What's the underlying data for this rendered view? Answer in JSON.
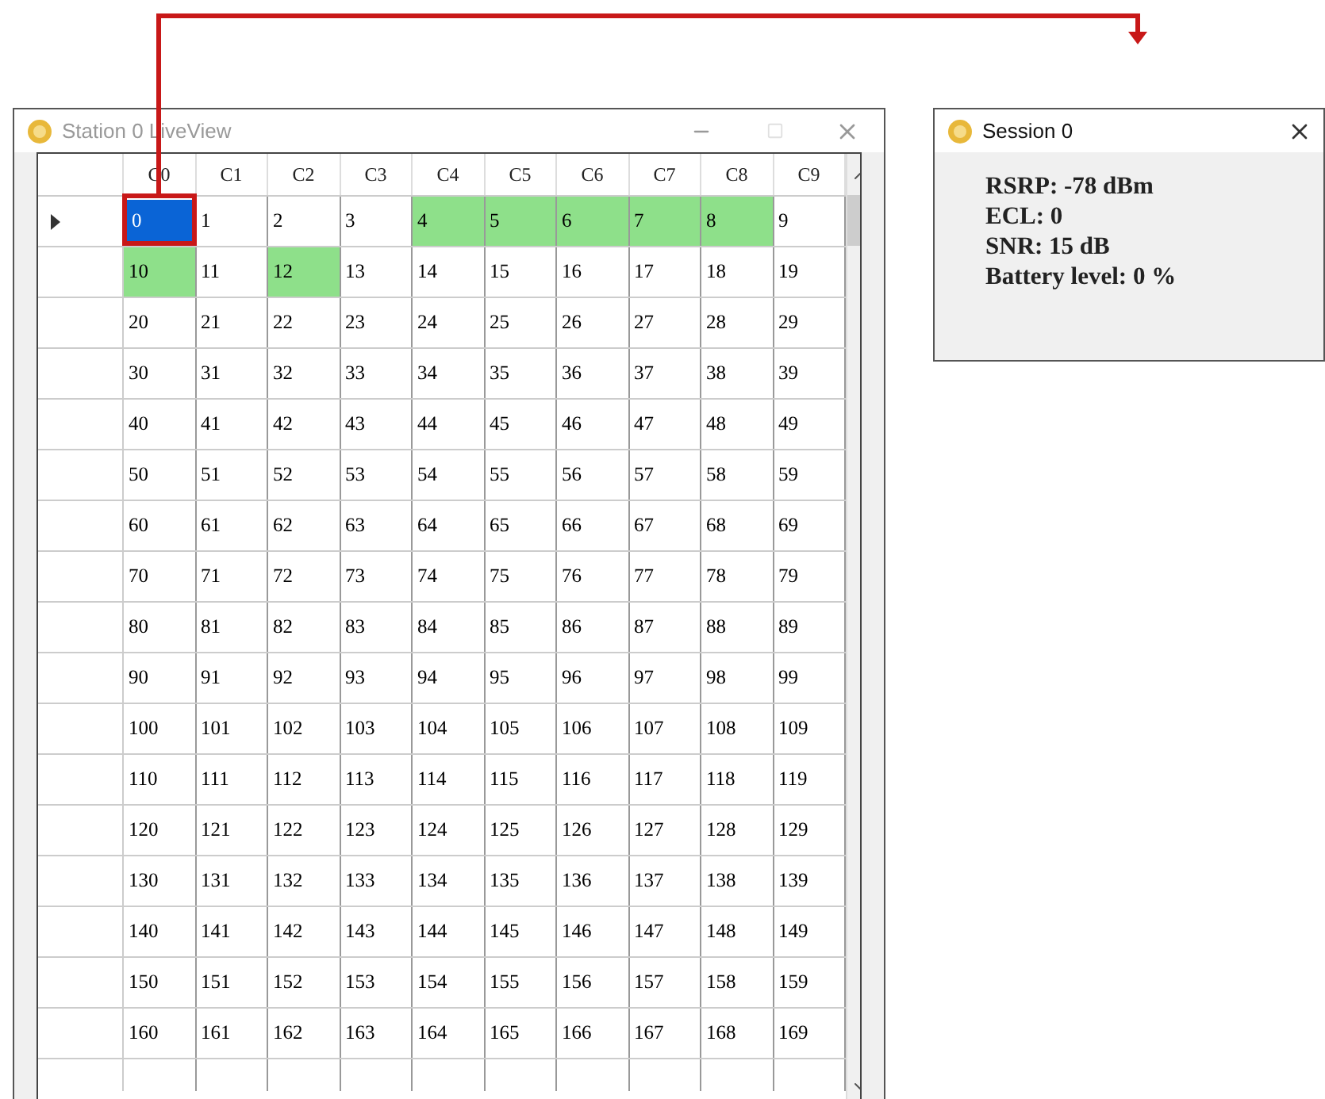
{
  "live_view_window": {
    "title": "Station 0 LiveView",
    "maximize_disabled": true,
    "grid": {
      "columns": [
        "C0",
        "C1",
        "C2",
        "C3",
        "C4",
        "C5",
        "C6",
        "C7",
        "C8",
        "C9"
      ],
      "rows": [
        {
          "current": true,
          "cells": [
            {
              "text": "0",
              "selected": true,
              "highlighted": false
            },
            {
              "text": "1",
              "selected": false,
              "highlighted": false
            },
            {
              "text": "2",
              "selected": false,
              "highlighted": false
            },
            {
              "text": "3",
              "selected": false,
              "highlighted": false
            },
            {
              "text": "4",
              "selected": false,
              "highlighted": true
            },
            {
              "text": "5",
              "selected": false,
              "highlighted": true
            },
            {
              "text": "6",
              "selected": false,
              "highlighted": true
            },
            {
              "text": "7",
              "selected": false,
              "highlighted": true
            },
            {
              "text": "8",
              "selected": false,
              "highlighted": true
            },
            {
              "text": "9",
              "selected": false,
              "highlighted": false
            }
          ]
        },
        {
          "current": false,
          "cells": [
            {
              "text": "10",
              "selected": false,
              "highlighted": true
            },
            {
              "text": "11",
              "selected": false,
              "highlighted": false
            },
            {
              "text": "12",
              "selected": false,
              "highlighted": true
            },
            {
              "text": "13",
              "selected": false,
              "highlighted": false
            },
            {
              "text": "14",
              "selected": false,
              "highlighted": false
            },
            {
              "text": "15",
              "selected": false,
              "highlighted": false
            },
            {
              "text": "16",
              "selected": false,
              "highlighted": false
            },
            {
              "text": "17",
              "selected": false,
              "highlighted": false
            },
            {
              "text": "18",
              "selected": false,
              "highlighted": false
            },
            {
              "text": "19",
              "selected": false,
              "highlighted": false
            }
          ]
        },
        {
          "current": false,
          "cells": [
            {
              "text": "20",
              "selected": false,
              "highlighted": false
            },
            {
              "text": "21",
              "selected": false,
              "highlighted": false
            },
            {
              "text": "22",
              "selected": false,
              "highlighted": false
            },
            {
              "text": "23",
              "selected": false,
              "highlighted": false
            },
            {
              "text": "24",
              "selected": false,
              "highlighted": false
            },
            {
              "text": "25",
              "selected": false,
              "highlighted": false
            },
            {
              "text": "26",
              "selected": false,
              "highlighted": false
            },
            {
              "text": "27",
              "selected": false,
              "highlighted": false
            },
            {
              "text": "28",
              "selected": false,
              "highlighted": false
            },
            {
              "text": "29",
              "selected": false,
              "highlighted": false
            }
          ]
        },
        {
          "current": false,
          "cells": [
            {
              "text": "30",
              "selected": false,
              "highlighted": false
            },
            {
              "text": "31",
              "selected": false,
              "highlighted": false
            },
            {
              "text": "32",
              "selected": false,
              "highlighted": false
            },
            {
              "text": "33",
              "selected": false,
              "highlighted": false
            },
            {
              "text": "34",
              "selected": false,
              "highlighted": false
            },
            {
              "text": "35",
              "selected": false,
              "highlighted": false
            },
            {
              "text": "36",
              "selected": false,
              "highlighted": false
            },
            {
              "text": "37",
              "selected": false,
              "highlighted": false
            },
            {
              "text": "38",
              "selected": false,
              "highlighted": false
            },
            {
              "text": "39",
              "selected": false,
              "highlighted": false
            }
          ]
        },
        {
          "current": false,
          "cells": [
            {
              "text": "40",
              "selected": false,
              "highlighted": false
            },
            {
              "text": "41",
              "selected": false,
              "highlighted": false
            },
            {
              "text": "42",
              "selected": false,
              "highlighted": false
            },
            {
              "text": "43",
              "selected": false,
              "highlighted": false
            },
            {
              "text": "44",
              "selected": false,
              "highlighted": false
            },
            {
              "text": "45",
              "selected": false,
              "highlighted": false
            },
            {
              "text": "46",
              "selected": false,
              "highlighted": false
            },
            {
              "text": "47",
              "selected": false,
              "highlighted": false
            },
            {
              "text": "48",
              "selected": false,
              "highlighted": false
            },
            {
              "text": "49",
              "selected": false,
              "highlighted": false
            }
          ]
        },
        {
          "current": false,
          "cells": [
            {
              "text": "50",
              "selected": false,
              "highlighted": false
            },
            {
              "text": "51",
              "selected": false,
              "highlighted": false
            },
            {
              "text": "52",
              "selected": false,
              "highlighted": false
            },
            {
              "text": "53",
              "selected": false,
              "highlighted": false
            },
            {
              "text": "54",
              "selected": false,
              "highlighted": false
            },
            {
              "text": "55",
              "selected": false,
              "highlighted": false
            },
            {
              "text": "56",
              "selected": false,
              "highlighted": false
            },
            {
              "text": "57",
              "selected": false,
              "highlighted": false
            },
            {
              "text": "58",
              "selected": false,
              "highlighted": false
            },
            {
              "text": "59",
              "selected": false,
              "highlighted": false
            }
          ]
        },
        {
          "current": false,
          "cells": [
            {
              "text": "60",
              "selected": false,
              "highlighted": false
            },
            {
              "text": "61",
              "selected": false,
              "highlighted": false
            },
            {
              "text": "62",
              "selected": false,
              "highlighted": false
            },
            {
              "text": "63",
              "selected": false,
              "highlighted": false
            },
            {
              "text": "64",
              "selected": false,
              "highlighted": false
            },
            {
              "text": "65",
              "selected": false,
              "highlighted": false
            },
            {
              "text": "66",
              "selected": false,
              "highlighted": false
            },
            {
              "text": "67",
              "selected": false,
              "highlighted": false
            },
            {
              "text": "68",
              "selected": false,
              "highlighted": false
            },
            {
              "text": "69",
              "selected": false,
              "highlighted": false
            }
          ]
        },
        {
          "current": false,
          "cells": [
            {
              "text": "70",
              "selected": false,
              "highlighted": false
            },
            {
              "text": "71",
              "selected": false,
              "highlighted": false
            },
            {
              "text": "72",
              "selected": false,
              "highlighted": false
            },
            {
              "text": "73",
              "selected": false,
              "highlighted": false
            },
            {
              "text": "74",
              "selected": false,
              "highlighted": false
            },
            {
              "text": "75",
              "selected": false,
              "highlighted": false
            },
            {
              "text": "76",
              "selected": false,
              "highlighted": false
            },
            {
              "text": "77",
              "selected": false,
              "highlighted": false
            },
            {
              "text": "78",
              "selected": false,
              "highlighted": false
            },
            {
              "text": "79",
              "selected": false,
              "highlighted": false
            }
          ]
        },
        {
          "current": false,
          "cells": [
            {
              "text": "80",
              "selected": false,
              "highlighted": false
            },
            {
              "text": "81",
              "selected": false,
              "highlighted": false
            },
            {
              "text": "82",
              "selected": false,
              "highlighted": false
            },
            {
              "text": "83",
              "selected": false,
              "highlighted": false
            },
            {
              "text": "84",
              "selected": false,
              "highlighted": false
            },
            {
              "text": "85",
              "selected": false,
              "highlighted": false
            },
            {
              "text": "86",
              "selected": false,
              "highlighted": false
            },
            {
              "text": "87",
              "selected": false,
              "highlighted": false
            },
            {
              "text": "88",
              "selected": false,
              "highlighted": false
            },
            {
              "text": "89",
              "selected": false,
              "highlighted": false
            }
          ]
        },
        {
          "current": false,
          "cells": [
            {
              "text": "90",
              "selected": false,
              "highlighted": false
            },
            {
              "text": "91",
              "selected": false,
              "highlighted": false
            },
            {
              "text": "92",
              "selected": false,
              "highlighted": false
            },
            {
              "text": "93",
              "selected": false,
              "highlighted": false
            },
            {
              "text": "94",
              "selected": false,
              "highlighted": false
            },
            {
              "text": "95",
              "selected": false,
              "highlighted": false
            },
            {
              "text": "96",
              "selected": false,
              "highlighted": false
            },
            {
              "text": "97",
              "selected": false,
              "highlighted": false
            },
            {
              "text": "98",
              "selected": false,
              "highlighted": false
            },
            {
              "text": "99",
              "selected": false,
              "highlighted": false
            }
          ]
        },
        {
          "current": false,
          "cells": [
            {
              "text": "100",
              "selected": false,
              "highlighted": false
            },
            {
              "text": "101",
              "selected": false,
              "highlighted": false
            },
            {
              "text": "102",
              "selected": false,
              "highlighted": false
            },
            {
              "text": "103",
              "selected": false,
              "highlighted": false
            },
            {
              "text": "104",
              "selected": false,
              "highlighted": false
            },
            {
              "text": "105",
              "selected": false,
              "highlighted": false
            },
            {
              "text": "106",
              "selected": false,
              "highlighted": false
            },
            {
              "text": "107",
              "selected": false,
              "highlighted": false
            },
            {
              "text": "108",
              "selected": false,
              "highlighted": false
            },
            {
              "text": "109",
              "selected": false,
              "highlighted": false
            }
          ]
        },
        {
          "current": false,
          "cells": [
            {
              "text": "110",
              "selected": false,
              "highlighted": false
            },
            {
              "text": "111",
              "selected": false,
              "highlighted": false
            },
            {
              "text": "112",
              "selected": false,
              "highlighted": false
            },
            {
              "text": "113",
              "selected": false,
              "highlighted": false
            },
            {
              "text": "114",
              "selected": false,
              "highlighted": false
            },
            {
              "text": "115",
              "selected": false,
              "highlighted": false
            },
            {
              "text": "116",
              "selected": false,
              "highlighted": false
            },
            {
              "text": "117",
              "selected": false,
              "highlighted": false
            },
            {
              "text": "118",
              "selected": false,
              "highlighted": false
            },
            {
              "text": "119",
              "selected": false,
              "highlighted": false
            }
          ]
        },
        {
          "current": false,
          "cells": [
            {
              "text": "120",
              "selected": false,
              "highlighted": false
            },
            {
              "text": "121",
              "selected": false,
              "highlighted": false
            },
            {
              "text": "122",
              "selected": false,
              "highlighted": false
            },
            {
              "text": "123",
              "selected": false,
              "highlighted": false
            },
            {
              "text": "124",
              "selected": false,
              "highlighted": false
            },
            {
              "text": "125",
              "selected": false,
              "highlighted": false
            },
            {
              "text": "126",
              "selected": false,
              "highlighted": false
            },
            {
              "text": "127",
              "selected": false,
              "highlighted": false
            },
            {
              "text": "128",
              "selected": false,
              "highlighted": false
            },
            {
              "text": "129",
              "selected": false,
              "highlighted": false
            }
          ]
        },
        {
          "current": false,
          "cells": [
            {
              "text": "130",
              "selected": false,
              "highlighted": false
            },
            {
              "text": "131",
              "selected": false,
              "highlighted": false
            },
            {
              "text": "132",
              "selected": false,
              "highlighted": false
            },
            {
              "text": "133",
              "selected": false,
              "highlighted": false
            },
            {
              "text": "134",
              "selected": false,
              "highlighted": false
            },
            {
              "text": "135",
              "selected": false,
              "highlighted": false
            },
            {
              "text": "136",
              "selected": false,
              "highlighted": false
            },
            {
              "text": "137",
              "selected": false,
              "highlighted": false
            },
            {
              "text": "138",
              "selected": false,
              "highlighted": false
            },
            {
              "text": "139",
              "selected": false,
              "highlighted": false
            }
          ]
        },
        {
          "current": false,
          "cells": [
            {
              "text": "140",
              "selected": false,
              "highlighted": false
            },
            {
              "text": "141",
              "selected": false,
              "highlighted": false
            },
            {
              "text": "142",
              "selected": false,
              "highlighted": false
            },
            {
              "text": "143",
              "selected": false,
              "highlighted": false
            },
            {
              "text": "144",
              "selected": false,
              "highlighted": false
            },
            {
              "text": "145",
              "selected": false,
              "highlighted": false
            },
            {
              "text": "146",
              "selected": false,
              "highlighted": false
            },
            {
              "text": "147",
              "selected": false,
              "highlighted": false
            },
            {
              "text": "148",
              "selected": false,
              "highlighted": false
            },
            {
              "text": "149",
              "selected": false,
              "highlighted": false
            }
          ]
        },
        {
          "current": false,
          "cells": [
            {
              "text": "150",
              "selected": false,
              "highlighted": false
            },
            {
              "text": "151",
              "selected": false,
              "highlighted": false
            },
            {
              "text": "152",
              "selected": false,
              "highlighted": false
            },
            {
              "text": "153",
              "selected": false,
              "highlighted": false
            },
            {
              "text": "154",
              "selected": false,
              "highlighted": false
            },
            {
              "text": "155",
              "selected": false,
              "highlighted": false
            },
            {
              "text": "156",
              "selected": false,
              "highlighted": false
            },
            {
              "text": "157",
              "selected": false,
              "highlighted": false
            },
            {
              "text": "158",
              "selected": false,
              "highlighted": false
            },
            {
              "text": "159",
              "selected": false,
              "highlighted": false
            }
          ]
        },
        {
          "current": false,
          "cells": [
            {
              "text": "160",
              "selected": false,
              "highlighted": false
            },
            {
              "text": "161",
              "selected": false,
              "highlighted": false
            },
            {
              "text": "162",
              "selected": false,
              "highlighted": false
            },
            {
              "text": "163",
              "selected": false,
              "highlighted": false
            },
            {
              "text": "164",
              "selected": false,
              "highlighted": false
            },
            {
              "text": "165",
              "selected": false,
              "highlighted": false
            },
            {
              "text": "166",
              "selected": false,
              "highlighted": false
            },
            {
              "text": "167",
              "selected": false,
              "highlighted": false
            },
            {
              "text": "168",
              "selected": false,
              "highlighted": false
            },
            {
              "text": "169",
              "selected": false,
              "highlighted": false
            }
          ]
        }
      ]
    }
  },
  "session_window": {
    "title": "Session 0",
    "lines": [
      "RSRP: -78 dBm",
      "ECL: 0",
      "SNR: 15 dB",
      "Battery level: 0 %"
    ]
  }
}
